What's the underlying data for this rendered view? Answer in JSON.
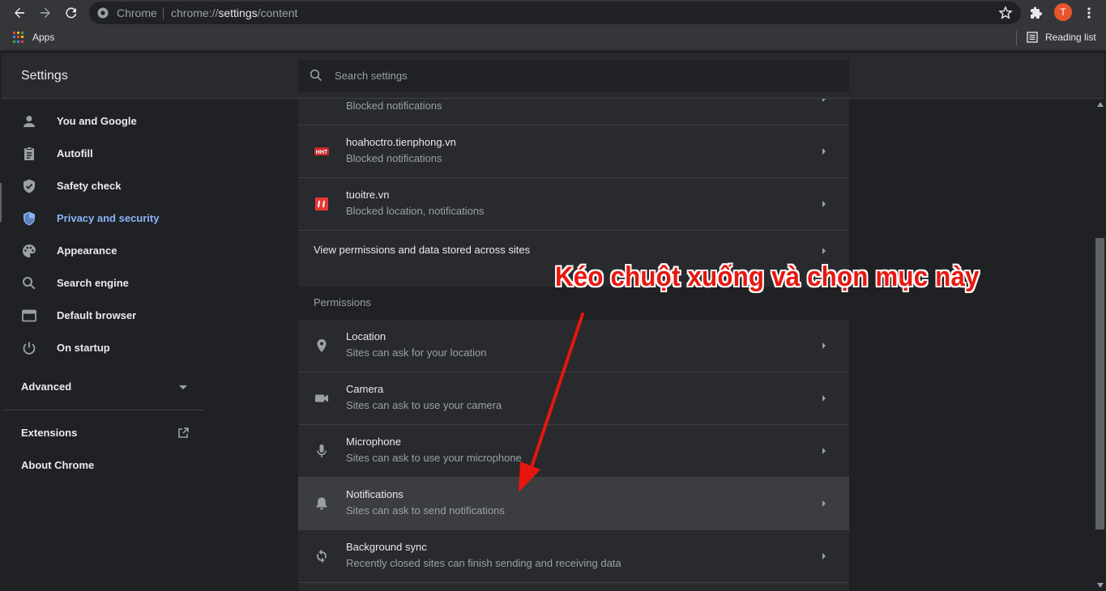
{
  "browser": {
    "omnibox_site": "Chrome",
    "url_prefix": "chrome://",
    "url_host": "settings",
    "url_path": "/content",
    "avatar_letter": "T",
    "apps_label": "Apps",
    "reading_list_label": "Reading list"
  },
  "header": {
    "title": "Settings",
    "search_placeholder": "Search settings"
  },
  "sidebar": {
    "items": [
      {
        "label": "You and Google",
        "icon": "person-icon"
      },
      {
        "label": "Autofill",
        "icon": "clipboard-icon"
      },
      {
        "label": "Safety check",
        "icon": "shield-check-icon"
      },
      {
        "label": "Privacy and security",
        "icon": "shield-icon",
        "active": true
      },
      {
        "label": "Appearance",
        "icon": "palette-icon"
      },
      {
        "label": "Search engine",
        "icon": "search-icon"
      },
      {
        "label": "Default browser",
        "icon": "browser-icon"
      },
      {
        "label": "On startup",
        "icon": "power-icon"
      }
    ],
    "advanced_label": "Advanced",
    "extensions_label": "Extensions",
    "about_label": "About Chrome"
  },
  "content": {
    "sites": [
      {
        "title": "",
        "subtitle": "Blocked notifications"
      },
      {
        "title": "hoahoctro.tienphong.vn",
        "subtitle": "Blocked notifications"
      },
      {
        "title": "tuoitre.vn",
        "subtitle": "Blocked location, notifications"
      }
    ],
    "view_permissions_label": "View permissions and data stored across sites",
    "permissions_heading": "Permissions",
    "permissions": [
      {
        "title": "Location",
        "subtitle": "Sites can ask for your location",
        "icon": "location-pin-icon"
      },
      {
        "title": "Camera",
        "subtitle": "Sites can ask to use your camera",
        "icon": "camera-icon"
      },
      {
        "title": "Microphone",
        "subtitle": "Sites can ask to use your microphone",
        "icon": "microphone-icon"
      },
      {
        "title": "Notifications",
        "subtitle": "Sites can ask to send notifications",
        "icon": "bell-icon",
        "highlighted": true
      },
      {
        "title": "Background sync",
        "subtitle": "Recently closed sites can finish sending and receiving data",
        "icon": "sync-icon"
      }
    ]
  },
  "annotation": {
    "text": "Kéo chuột xuống và chọn mục này",
    "color": "#e8170e"
  },
  "colors": {
    "accent": "#8ab4f8",
    "background": "#202124",
    "card": "#292a2d"
  }
}
